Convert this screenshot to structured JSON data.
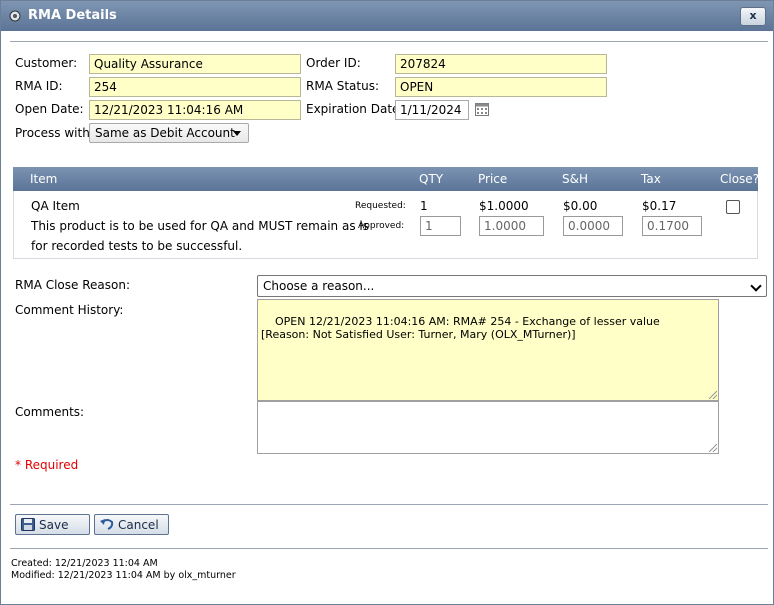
{
  "window": {
    "title": "RMA Details",
    "close_label": "x"
  },
  "form": {
    "customer_label": "Customer:",
    "customer_value": "Quality Assurance",
    "order_id_label": "Order ID:",
    "order_id_value": "207824",
    "rma_id_label": "RMA ID:",
    "rma_id_value": "254",
    "rma_status_label": "RMA Status:",
    "rma_status_value": "OPEN",
    "open_date_label": "Open Date:",
    "open_date_value": "12/21/2023 11:04:16 AM",
    "expiration_label": "Expiration Date:",
    "expiration_value": "1/11/2024",
    "process_label": "Process with:",
    "process_value": "Same as Debit Account"
  },
  "table": {
    "headers": {
      "item": "Item",
      "qty": "QTY",
      "price": "Price",
      "sh": "S&H",
      "tax": "Tax",
      "close": "Close?"
    },
    "row": {
      "item_name": "QA Item",
      "item_desc_1": "This product is to be used for QA and MUST remain as is",
      "item_desc_2": "for recorded tests to be successful.",
      "requested_label": "Requested:",
      "approved_label": "Approved:",
      "req_qty": "1",
      "req_price": "$1.0000",
      "req_sh": "$0.00",
      "req_tax": "$0.17",
      "app_qty": "1",
      "app_price": "1.0000",
      "app_sh": "0.0000",
      "app_tax": "0.1700",
      "close_checked": false
    }
  },
  "close_reason": {
    "label": "RMA Close Reason:",
    "value": "Choose a reason..."
  },
  "comment_history": {
    "label": "Comment History:",
    "text": "OPEN 12/21/2023 11:04:16 AM: RMA# 254 - Exchange of lesser value\n[Reason: Not Satisfied User: Turner, Mary (OLX_MTurner)]"
  },
  "comments": {
    "label": "Comments:",
    "value": ""
  },
  "required_note": "* Required",
  "buttons": {
    "save": "Save",
    "cancel": "Cancel"
  },
  "footer": {
    "created": "Created: 12/21/2023 11:04 AM",
    "modified": "Modified: 12/21/2023 11:04 AM by olx_mturner"
  },
  "colors": {
    "titlebar": "#5b7396",
    "highlight_field": "#ffffc7",
    "required": "#e00000"
  },
  "icons": {
    "title": "gear-icon",
    "close": "close-icon",
    "calendar": "calendar-icon",
    "save": "floppy-disk-icon",
    "cancel": "undo-icon"
  }
}
